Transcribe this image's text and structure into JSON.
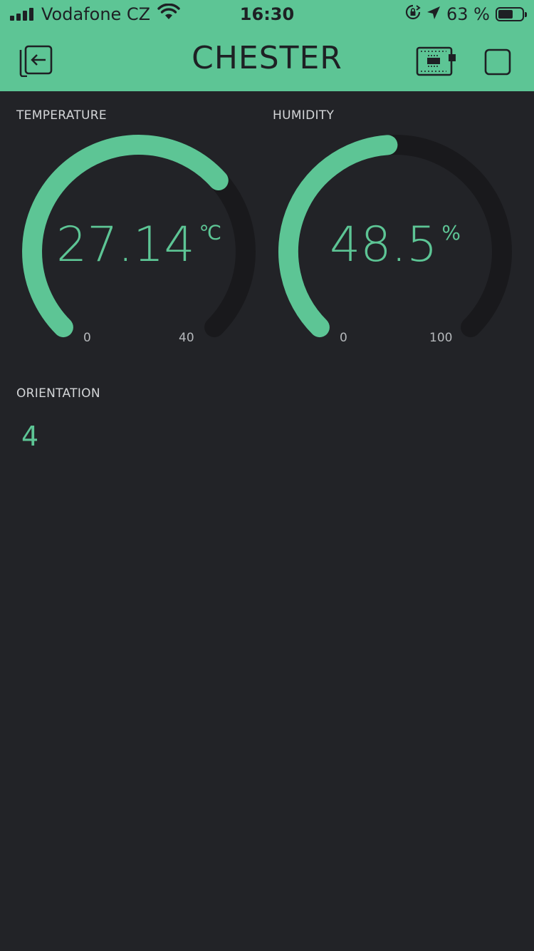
{
  "status_bar": {
    "carrier": "Vodafone CZ",
    "time": "16:30",
    "battery_text": "63 %",
    "battery_level": 0.63,
    "icons": [
      "signal-icon",
      "wifi-icon",
      "rotation-lock-icon",
      "location-arrow-icon",
      "battery-icon"
    ]
  },
  "header": {
    "title": "CHESTER",
    "back_icon": "exit-icon",
    "device_icon": "device-board-icon",
    "stop_icon": "stop-square-icon"
  },
  "colors": {
    "accent": "#5dc595",
    "background": "#222327",
    "track": "#19191c"
  },
  "widgets": {
    "temperature": {
      "label": "TEMPERATURE",
      "value": "27.14",
      "unit": "℃",
      "min": "0",
      "max": "40",
      "numeric_value": 27.14,
      "numeric_min": 0,
      "numeric_max": 40
    },
    "humidity": {
      "label": "HUMIDITY",
      "value": "48.5",
      "unit": "%",
      "min": "0",
      "max": "100",
      "numeric_value": 48.5,
      "numeric_min": 0,
      "numeric_max": 100
    },
    "orientation": {
      "label": "ORIENTATION",
      "value": "4"
    }
  }
}
